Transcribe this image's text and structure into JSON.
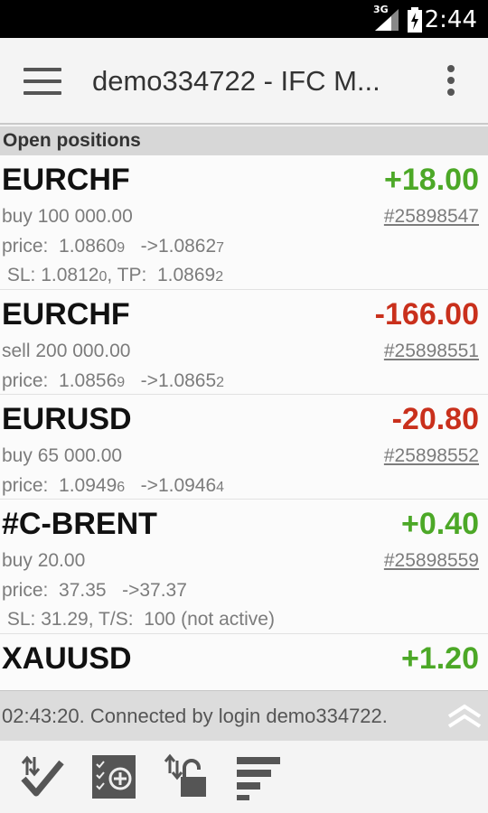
{
  "status_bar": {
    "time": "2:44",
    "network": "3G"
  },
  "app_bar": {
    "title": "demo334722 - IFC M..."
  },
  "section": {
    "title": "Open positions"
  },
  "positions": [
    {
      "symbol": "EURCHF",
      "profit": "+18.00",
      "side": "buy 100 000.00",
      "ticket": "#25898547",
      "price_open": "1.0860",
      "price_open_small": "9",
      "price_cur": "1.0862",
      "price_cur_small": "7",
      "sltp_a": "1.0812",
      "sltp_a_small": "0",
      "sltp_b": "1.0869",
      "sltp_b_small": "2"
    },
    {
      "symbol": "EURCHF",
      "profit": "-166.00",
      "side": "sell 200 000.00",
      "ticket": "#25898551",
      "price_open": "1.0856",
      "price_open_small": "9",
      "price_cur": "1.0865",
      "price_cur_small": "2"
    },
    {
      "symbol": "EURUSD",
      "profit": "-20.80",
      "side": "buy 65 000.00",
      "ticket": "#25898552",
      "price_open": "1.0949",
      "price_open_small": "6",
      "price_cur": "1.0946",
      "price_cur_small": "4"
    },
    {
      "symbol": "#C-BRENT",
      "profit": "+0.40",
      "side": "buy 20.00",
      "ticket": "#25898559",
      "price_open": "37.35",
      "price_cur": "37.37",
      "sl_ts": " SL: 31.29, T/S:  100 (not active)"
    },
    {
      "symbol": "XAUUSD",
      "profit": "+1.20"
    }
  ],
  "labels": {
    "price": "price:  ",
    "arrow": "   ->",
    "sl": " SL: ",
    "tp": ", TP:  "
  },
  "status_line": {
    "text": "02:43:20. Connected by login demo334722."
  },
  "colors": {
    "profit_positive": "#4ca827",
    "profit_negative": "#c9301c"
  },
  "toolbar": {
    "icons": [
      "trade-check-icon",
      "add-order-icon",
      "unlock-icon",
      "sort-icon"
    ]
  }
}
